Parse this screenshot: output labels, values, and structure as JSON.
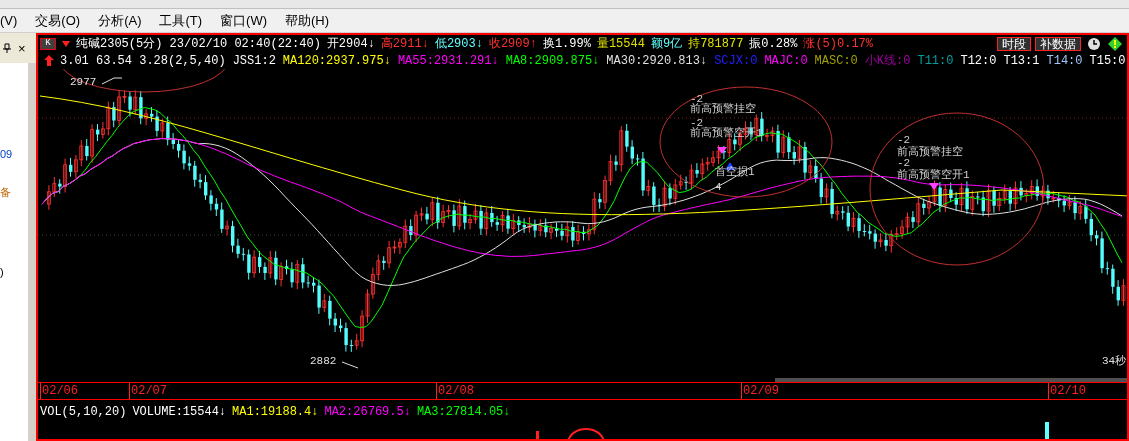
{
  "menu": [
    {
      "label": "(V)"
    },
    {
      "label": "交易(O)"
    },
    {
      "label": "分析(A)"
    },
    {
      "label": "工具(T)"
    },
    {
      "label": "窗口(W)"
    },
    {
      "label": "帮助(H)"
    }
  ],
  "left_panel": {
    "close": "×",
    "texts": [
      "09",
      "备",
      ")"
    ]
  },
  "chart_button": {
    "label": "K"
  },
  "header_row1": [
    {
      "text": "纯碱2305(5分) 23/02/10 02:40(22:40)",
      "color": "#ffffff"
    },
    {
      "text": "开2904↓",
      "color": "#ffffff"
    },
    {
      "text": "高2911↓",
      "color": "#ff3030"
    },
    {
      "text": "低2903↓",
      "color": "#60ffff"
    },
    {
      "text": "收2909↑",
      "color": "#ff3030"
    },
    {
      "text": "换1.99%",
      "color": "#ffffff"
    },
    {
      "text": "量15544",
      "color": "#e0e000"
    },
    {
      "text": "额9亿",
      "color": "#60ffff"
    },
    {
      "text": "持781877",
      "color": "#e0e000"
    },
    {
      "text": "振0.28%",
      "color": "#ffffff"
    },
    {
      "text": "涨(5)0.17%",
      "color": "#ff3030"
    }
  ],
  "header_buttons": [
    {
      "label": "时段"
    },
    {
      "label": "补数据"
    }
  ],
  "header_row2": [
    {
      "text": "3.01 63.54 3.28(2,5,40)",
      "color": "#ffffff"
    },
    {
      "text": "JSS1:2",
      "color": "#ffffff"
    },
    {
      "text": "MA120:2937.975↓",
      "color": "#ffff00"
    },
    {
      "text": "MA55:2931.291↓",
      "color": "#ff00ff"
    },
    {
      "text": "MA8:2909.875↓",
      "color": "#00ff00"
    },
    {
      "text": "MA30:2920.813↓",
      "color": "#e0e0e0"
    },
    {
      "text": "SCJX:0",
      "color": "#2020ff"
    },
    {
      "text": "MAJC:0",
      "color": "#ff00ff"
    },
    {
      "text": "MASC:0",
      "color": "#a0a000"
    },
    {
      "text": "小K线:0",
      "color": "#a000a0"
    },
    {
      "text": "T11:0",
      "color": "#00a0a0"
    },
    {
      "text": "T12:0",
      "color": "#ffffff"
    },
    {
      "text": "T13:1",
      "color": "#ffffff"
    },
    {
      "text": "T14:0",
      "color": "#a0c8ff"
    },
    {
      "text": "T15:0",
      "color": "#ffffff"
    }
  ],
  "chart_labels": [
    {
      "kind": "high",
      "text": "2977"
    },
    {
      "kind": "low",
      "text": "2882"
    },
    {
      "kind": "timer",
      "text": "34秒"
    }
  ],
  "signals": [
    {
      "text": "-2"
    },
    {
      "text": "前高预警挂空"
    },
    {
      "text": "-2"
    },
    {
      "text": "前高预警空开1"
    },
    {
      "text": "首空损1"
    },
    {
      "text": "4"
    },
    {
      "text": "-2"
    },
    {
      "text": "前高预警挂空"
    },
    {
      "text": "-2"
    },
    {
      "text": "前高预警空开1"
    }
  ],
  "dates": [
    "02/06",
    "02/07",
    "02/08",
    "02/09",
    "02/10"
  ],
  "volume_header": [
    {
      "text": "VOL(5,10,20)",
      "color": "#ffffff"
    },
    {
      "text": "VOLUME:15544↓",
      "color": "#ffffff"
    },
    {
      "text": "MA1:19188.4↓",
      "color": "#ffff00"
    },
    {
      "text": "MA2:26769.5↓",
      "color": "#ff00ff"
    },
    {
      "text": "MA3:27814.05↓",
      "color": "#00ff00"
    }
  ]
}
